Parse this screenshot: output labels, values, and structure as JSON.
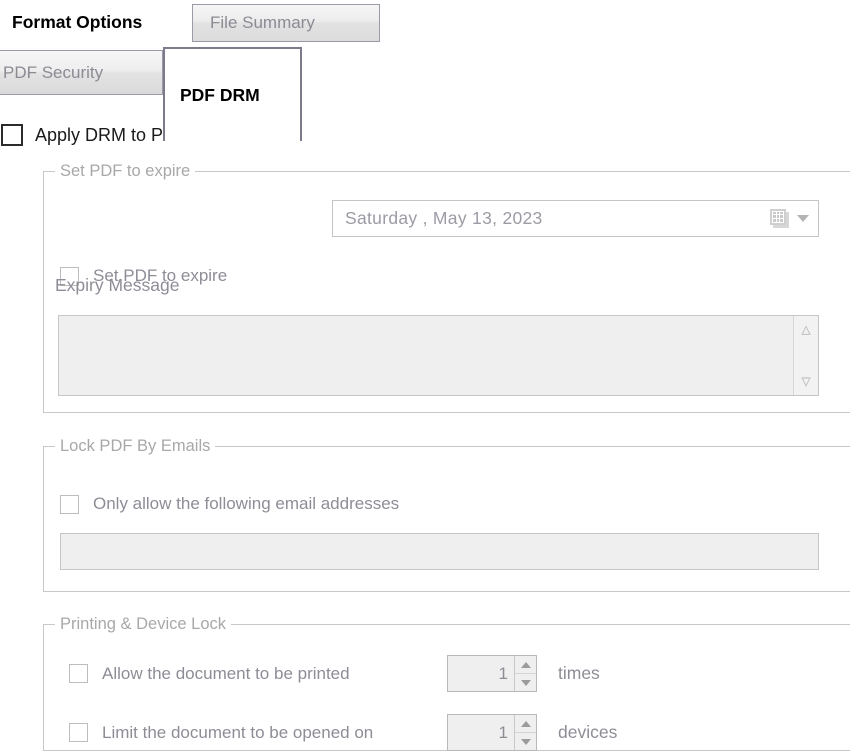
{
  "outer_tabs": [
    {
      "label": "Format Options",
      "selected": true
    },
    {
      "label": "File Summary",
      "selected": false
    }
  ],
  "inner_tabs": [
    {
      "label": "PDF Security",
      "selected": false
    },
    {
      "label": "PDF DRM",
      "selected": true
    }
  ],
  "apply_drm": {
    "label": "Apply DRM to PDF",
    "checked": false
  },
  "expire_group": {
    "legend": "Set PDF to expire",
    "checkbox_label": "Set PDF to expire",
    "checkbox_checked": false,
    "date_value": "Saturday ,    May    13, 2023",
    "calendar_icon": "calendar-icon",
    "dropdown_icon": "chevron-down-icon",
    "expiry_message_label": "Expiry  Message",
    "expiry_message_value": "",
    "scroll_up_icon": "chevron-up-icon",
    "scroll_down_icon": "chevron-down-icon"
  },
  "email_group": {
    "legend": "Lock PDF By Emails",
    "checkbox_label": "Only allow the following email addresses",
    "checkbox_checked": false,
    "email_value": "",
    "email_placeholder": ""
  },
  "printing_group": {
    "legend": "Printing & Device Lock",
    "rows": [
      {
        "checkbox_label": "Allow the document to be printed",
        "checkbox_checked": false,
        "value": "1",
        "unit": "times"
      },
      {
        "checkbox_label": "Limit the document to be opened on",
        "checkbox_checked": false,
        "value": "1",
        "unit": "devices"
      }
    ]
  },
  "colors": {
    "tab_border": "#7b7b8c",
    "disabled_text": "#8d8d96",
    "group_legend": "#a8a8a8",
    "disabled_field_bg": "#efefef",
    "panel_bg": "#ffffff"
  }
}
